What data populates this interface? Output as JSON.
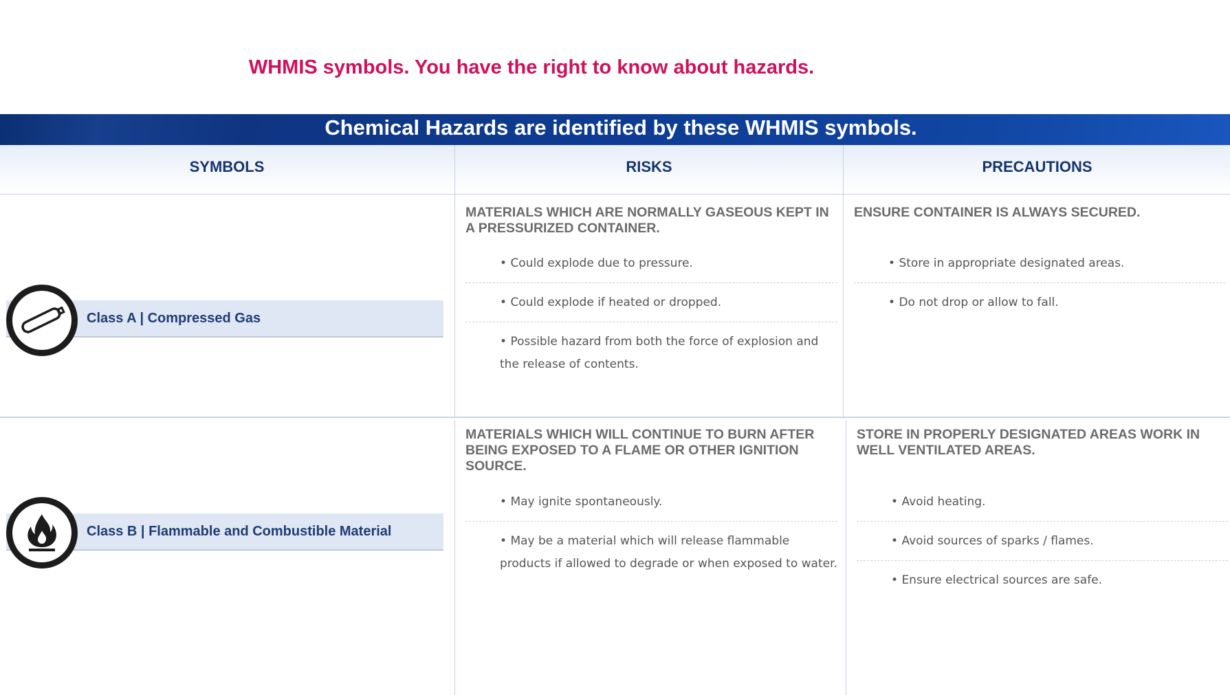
{
  "page": {
    "title": "WHMIS symbols. You have the right to know about hazards.",
    "banner_title": "Chemical Hazards are identified by these WHMIS symbols."
  },
  "table": {
    "headers": [
      "SYMBOLS",
      "RISKS",
      "PRECAUTIONS"
    ],
    "rows": [
      {
        "class_label": "Class A | Compressed Gas",
        "icon": "compressed-gas-cylinder-icon",
        "risks_heading": "MATERIALS WHICH ARE NORMALLY GASEOUS KEPT IN A PRESSURIZED CONTAINER.",
        "risks": [
          "Could explode due to pressure.",
          "Could explode if heated or dropped.",
          "Possible hazard from both the force of explosion and the release of contents."
        ],
        "precautions_heading": "ENSURE CONTAINER IS ALWAYS SECURED.",
        "precautions": [
          "Store in appropriate designated areas.",
          "Do not drop or allow to fall."
        ]
      },
      {
        "class_label": "Class B | Flammable and Combustible Material",
        "icon": "flame-icon",
        "risks_heading": "MATERIALS WHICH WILL CONTINUE TO BURN AFTER BEING EXPOSED TO A FLAME OR OTHER IGNITION SOURCE.",
        "risks": [
          "May ignite spontaneously.",
          "May be a material which will release flammable products if allowed to degrade or when exposed to water."
        ],
        "precautions_heading": "STORE IN PROPERLY DESIGNATED AREAS WORK IN WELL VENTILATED AREAS.",
        "precautions": [
          "Avoid heating.",
          "Avoid sources of sparks / flames.",
          "Ensure electrical sources are safe."
        ]
      }
    ]
  },
  "colors": {
    "title": "#d0105c",
    "banner": "#0e3d96",
    "header_text": "#16356d",
    "label_bar": "#dfe6f4"
  }
}
